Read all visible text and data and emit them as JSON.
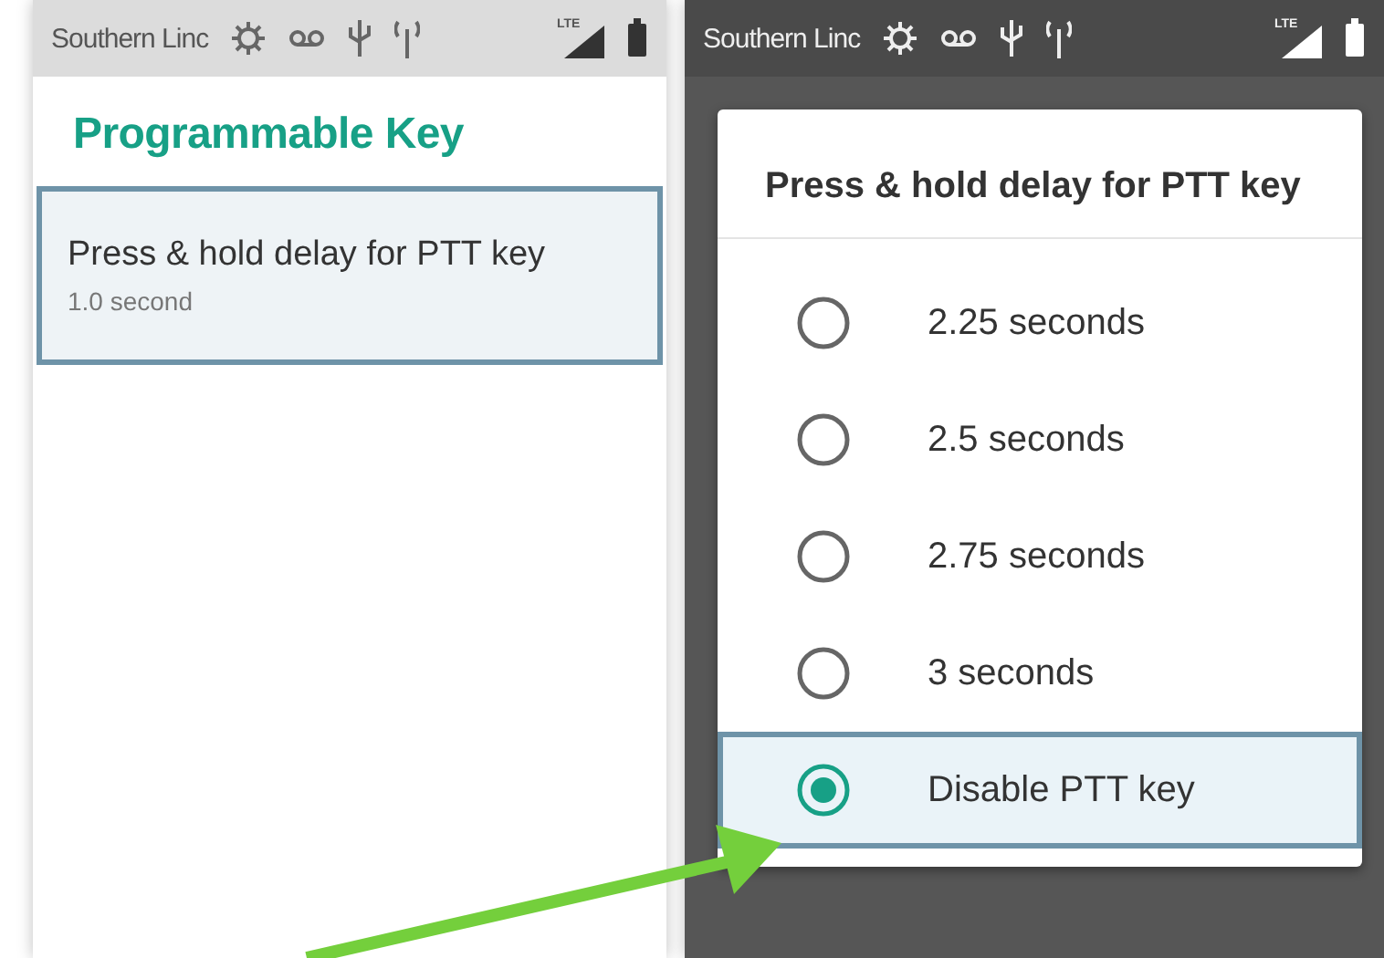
{
  "screens": [
    {
      "dimmed": false,
      "status_bar": {
        "carrier": "Southern Linc",
        "network": "LTE"
      },
      "page": {
        "title": "Programmable Key",
        "preferences": [
          {
            "title": "Press & hold delay for PTT key",
            "summary": "1.0 second",
            "selected": true
          }
        ]
      }
    },
    {
      "dimmed": true,
      "status_bar": {
        "carrier": "Southern Linc",
        "network": "LTE"
      },
      "dialog": {
        "title": "Press & hold delay for PTT key",
        "options": [
          {
            "label": "2.25 seconds",
            "selected": false
          },
          {
            "label": "2.5 seconds",
            "selected": false
          },
          {
            "label": "2.75 seconds",
            "selected": false
          },
          {
            "label": "3 seconds",
            "selected": false
          },
          {
            "label": "Disable PTT key",
            "selected": true
          }
        ]
      }
    }
  ]
}
